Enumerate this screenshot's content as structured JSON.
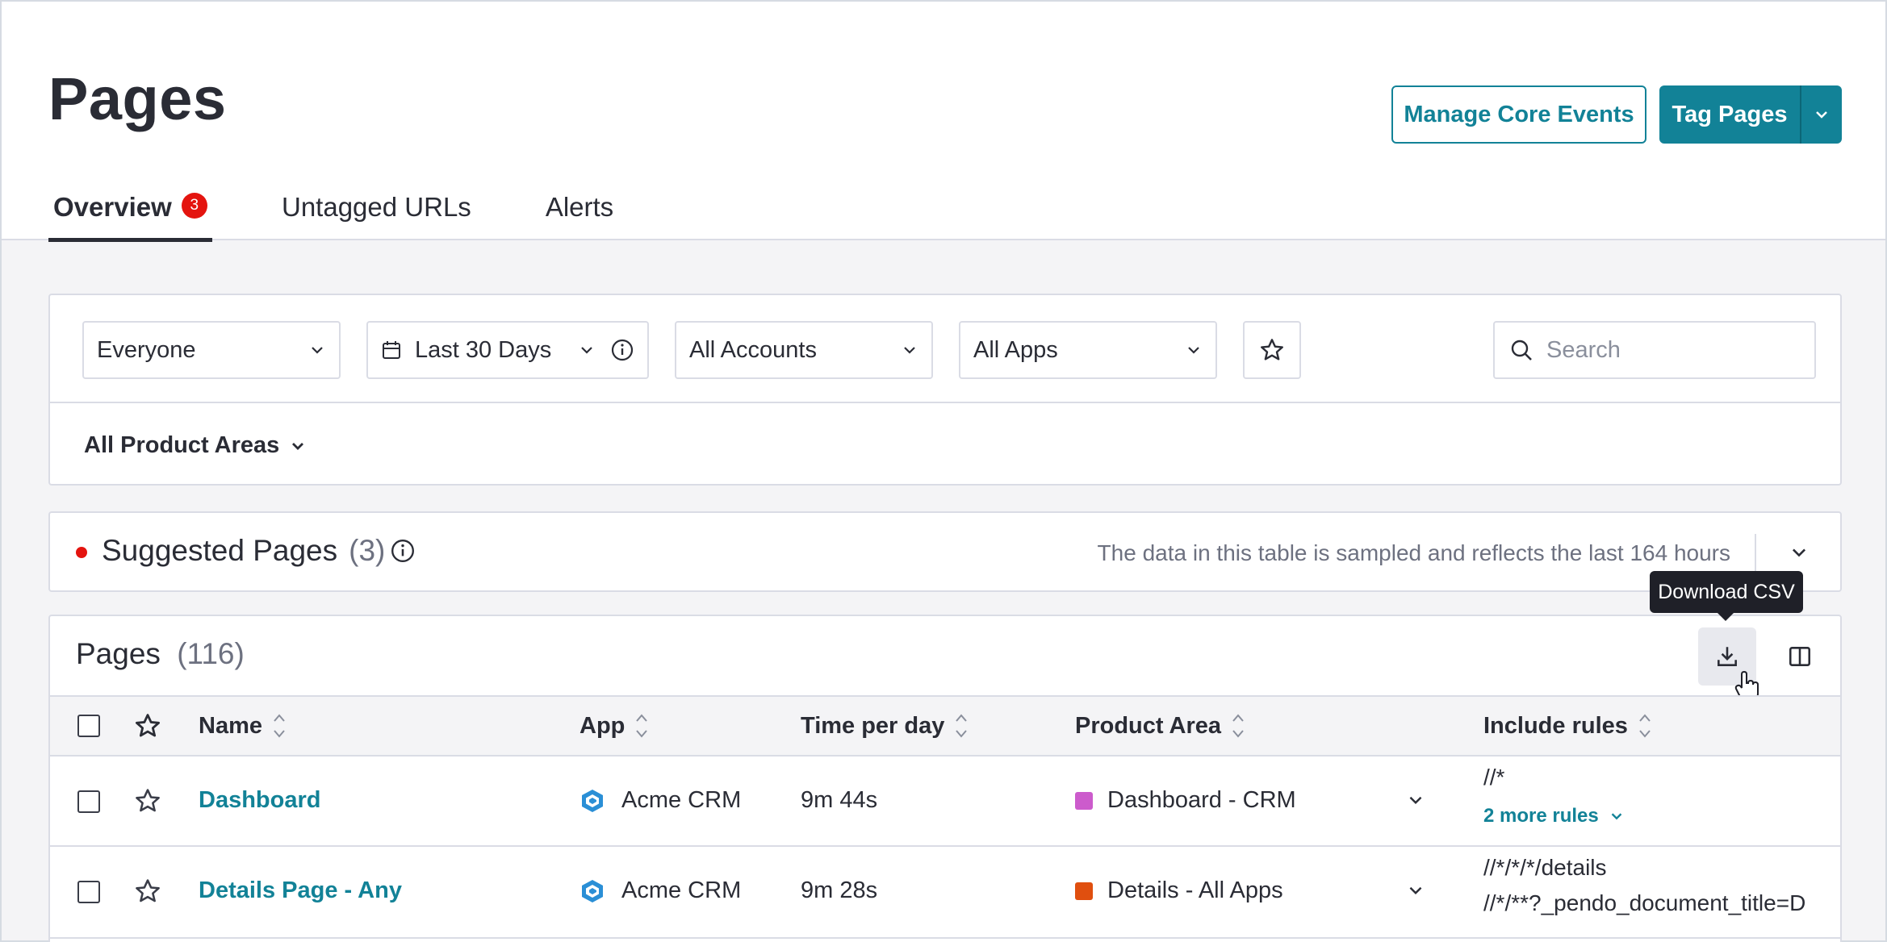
{
  "header": {
    "title": "Pages",
    "manage_button": "Manage Core Events",
    "tag_button": "Tag Pages"
  },
  "tabs": [
    {
      "label": "Overview",
      "badge": "3",
      "active": true
    },
    {
      "label": "Untagged URLs"
    },
    {
      "label": "Alerts"
    }
  ],
  "filters": {
    "segment": "Everyone",
    "date_range": "Last 30 Days",
    "accounts": "All Accounts",
    "apps": "All Apps",
    "search_placeholder": "Search",
    "product_areas": "All Product Areas"
  },
  "suggested": {
    "title": "Suggested Pages",
    "count": "(3)",
    "note": "The data in this table is sampled and reflects the last 164 hours"
  },
  "tooltip": "Download CSV",
  "pages_table": {
    "title": "Pages",
    "count": "(116)",
    "columns": [
      "Name",
      "App",
      "Time per day",
      "Product Area",
      "Include rules"
    ],
    "rows": [
      {
        "name": "Dashboard",
        "app": "Acme CRM",
        "time": "9m 44s",
        "product_area": "Dashboard - CRM",
        "product_area_color": "#cc5bcc",
        "rule_1": "//*",
        "more_rules": "2 more rules"
      },
      {
        "name": "Details Page - Any",
        "app": "Acme CRM",
        "time": "9m 28s",
        "product_area": "Details - All Apps",
        "product_area_color": "#e04f0f",
        "rule_1": "//*/*/*/details",
        "rule_2": "//*/**?_pendo_document_title=D"
      }
    ]
  },
  "colors": {
    "accent": "#128297",
    "alert": "#e4140f"
  }
}
